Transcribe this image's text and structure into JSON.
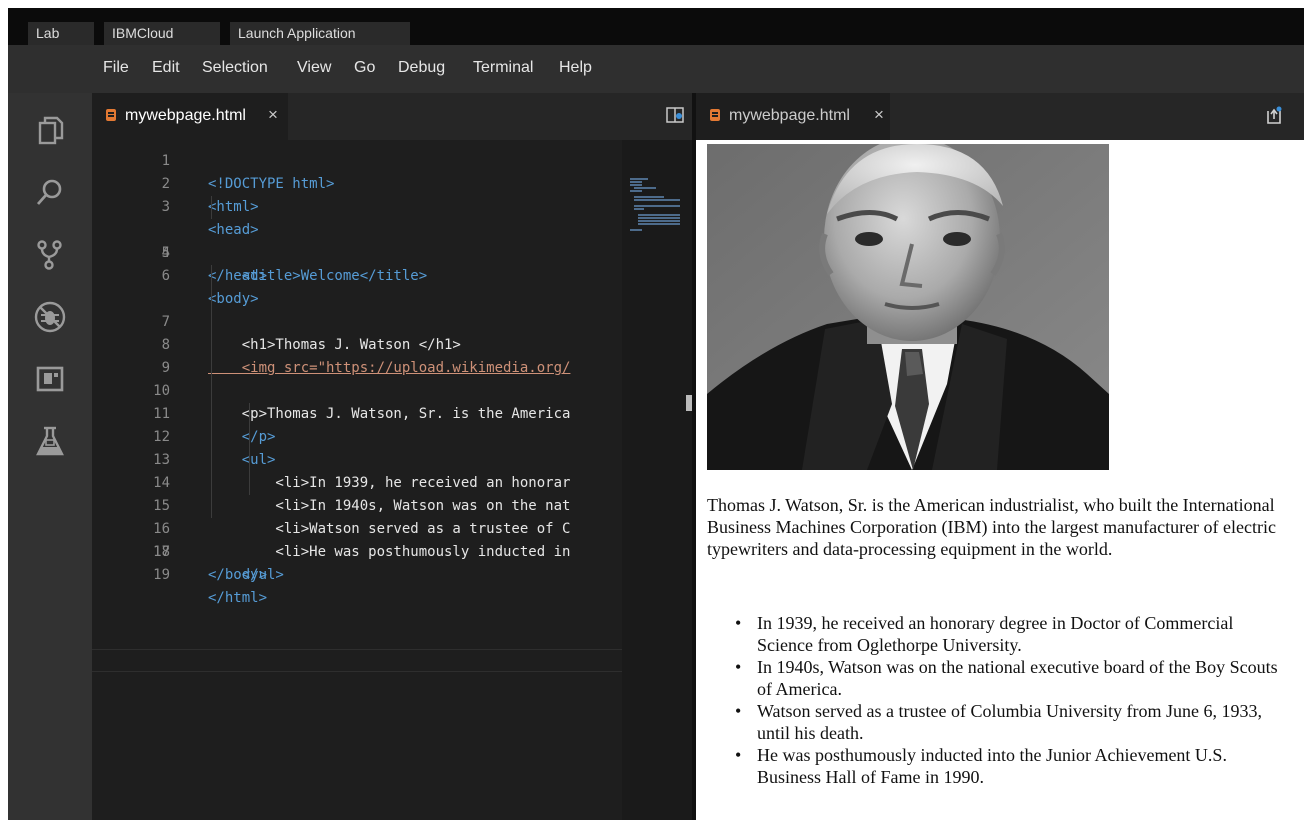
{
  "lab_tabs": [
    "Lab",
    "IBMCloud",
    "Launch Application"
  ],
  "menu": [
    "File",
    "Edit",
    "Selection",
    "View",
    "Go",
    "Debug",
    "Terminal",
    "Help"
  ],
  "activity_bar": [
    "files-icon",
    "search-icon",
    "source-control-icon",
    "debug-icon",
    "extensions-icon",
    "lab-flask-icon"
  ],
  "editor": {
    "tab_label": "mywebpage.html",
    "close_glyph": "×",
    "lines": [
      {
        "n": "1",
        "code": "<!DOCTYPE html>"
      },
      {
        "n": "2",
        "code": "<html>"
      },
      {
        "n": "3",
        "code": "<head>"
      },
      {
        "n": "4",
        "code": "    <title>Welcome</title>"
      },
      {
        "n": "5",
        "code": "</head>"
      },
      {
        "n": "6",
        "code": "<body>"
      },
      {
        "n": "7",
        "code": "    <h1>Thomas J. Watson </h1>"
      },
      {
        "n": "8",
        "code": "    <img src=\"https://upload.wikimedia.org/"
      },
      {
        "n": "9",
        "code": ""
      },
      {
        "n": "10",
        "code": "    <p>Thomas J. Watson, Sr. is the America"
      },
      {
        "n": "11",
        "code": "    </p>"
      },
      {
        "n": "12",
        "code": "    <ul>"
      },
      {
        "n": "13",
        "code": "        <li>In 1939, he received an honorar"
      },
      {
        "n": "14",
        "code": "        <li>In 1940s, Watson was on the nat"
      },
      {
        "n": "15",
        "code": "        <li>Watson served as a trustee of C"
      },
      {
        "n": "16",
        "code": "        <li>He was posthumously inducted in"
      },
      {
        "n": "17",
        "code": "    </ul>"
      },
      {
        "n": "18",
        "code": "</body>"
      },
      {
        "n": "19",
        "code": "</html>"
      }
    ]
  },
  "preview": {
    "tab_label": "mywebpage.html",
    "close_glyph": "×",
    "paragraph": "Thomas J. Watson, Sr. is the American industrialist, who built the International Business Machines Corporation (IBM) into the largest manufacturer of electric typewriters and data-processing equipment in the world.",
    "list": [
      "In 1939, he received an honorary degree in Doctor of Commercial Science from Oglethorpe University.",
      "In 1940s, Watson was on the national executive board of the Boy Scouts of America.",
      "Watson served as a trustee of Columbia University from June 6, 1933, until his death.",
      "He was posthumously inducted into the Junior Achievement U.S. Business Hall of Fame in 1990."
    ]
  },
  "colors": {
    "tag": "#569cd6",
    "text": "#e6e6e6",
    "attribute": "#9cdcfe",
    "string": "#ce9178",
    "html_file_icon": "#e37933"
  }
}
